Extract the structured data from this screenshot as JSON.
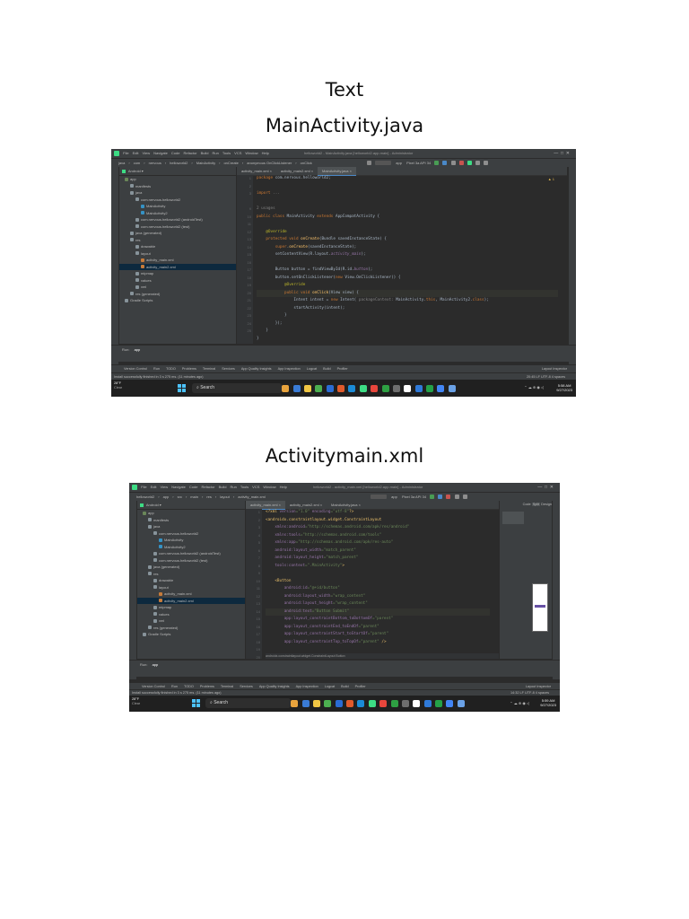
{
  "headings": {
    "text": "Text",
    "java": "MainActivity.java",
    "xml": "Activitymain.xml"
  },
  "ide": {
    "menu": [
      "File",
      "Edit",
      "View",
      "Navigate",
      "Code",
      "Refactor",
      "Build",
      "Run",
      "Tools",
      "VCS",
      "Window",
      "Help"
    ],
    "project_dropdown": "Android",
    "run_config": "app",
    "device": "Pixel 3a API 34",
    "bottom_tabs": [
      "Version Control",
      "Run",
      "TODO",
      "Problems",
      "Terminal",
      "Services",
      "App Quality Insights",
      "App Inspection",
      "Logcat",
      "Build",
      "Profiler"
    ],
    "layout_inspector": "Layout Inspector",
    "status_message": "Install successfully finished in 3 s 275 ms. (11 minutes ago)",
    "run_tab": "Run:",
    "run_app": "app"
  },
  "tree": [
    {
      "label": "app",
      "indent": 1,
      "color": "#6a8759"
    },
    {
      "label": "manifests",
      "indent": 2,
      "color": "#87939a"
    },
    {
      "label": "java",
      "indent": 2,
      "color": "#87939a"
    },
    {
      "label": "com.nervous.helloworld2",
      "indent": 3,
      "color": "#87939a"
    },
    {
      "label": "MainActivity",
      "indent": 4,
      "color": "#3592c4"
    },
    {
      "label": "MainActivity2",
      "indent": 4,
      "color": "#3592c4"
    },
    {
      "label": "com.nervous.helloworld2 (androidTest)",
      "indent": 3,
      "color": "#87939a"
    },
    {
      "label": "com.nervous.helloworld2 (test)",
      "indent": 3,
      "color": "#87939a"
    },
    {
      "label": "java (generated)",
      "indent": 2,
      "color": "#87939a"
    },
    {
      "label": "res",
      "indent": 2,
      "color": "#87939a"
    },
    {
      "label": "drawable",
      "indent": 3,
      "color": "#87939a"
    },
    {
      "label": "layout",
      "indent": 3,
      "color": "#87939a"
    },
    {
      "label": "activity_main.xml",
      "indent": 4,
      "color": "#c67b3a"
    },
    {
      "label": "activity_main2.xml",
      "indent": 4,
      "color": "#c67b3a"
    },
    {
      "label": "mipmap",
      "indent": 3,
      "color": "#87939a"
    },
    {
      "label": "values",
      "indent": 3,
      "color": "#87939a"
    },
    {
      "label": "xml",
      "indent": 3,
      "color": "#87939a"
    },
    {
      "label": "res (generated)",
      "indent": 2,
      "color": "#87939a"
    },
    {
      "label": "Gradle Scripts",
      "indent": 1,
      "color": "#87939a"
    }
  ],
  "shot1": {
    "title": "helloworld2 - MainActivity.java [helloworld2.app.main] - Administrator",
    "breadcrumb": [
      "java",
      "com",
      "nervous",
      "helloworld2",
      "MainActivity",
      "onCreate",
      "anonymous OnClickListener",
      "onClick"
    ],
    "tabs": [
      "activity_main.xml",
      "activity_main2.xml",
      "MainActivity.java"
    ],
    "line_numbers": [
      "1",
      "2",
      "3",
      "",
      "9",
      "10",
      "11",
      "12",
      "13",
      "14",
      "15",
      "16",
      "17",
      "18",
      "19",
      "20",
      "21",
      "22",
      "23",
      "24",
      "25"
    ],
    "code": [
      [
        [
          "kw",
          "package "
        ],
        [
          "",
          "com.nervous.helloworld2;"
        ]
      ],
      [
        [
          "",
          ""
        ]
      ],
      [
        [
          "kw",
          "import "
        ],
        [
          "cm",
          "..."
        ]
      ],
      [
        [
          "",
          ""
        ]
      ],
      [
        [
          "cm",
          "2 usages"
        ]
      ],
      [
        [
          "kw",
          "public class "
        ],
        [
          "",
          "MainActivity "
        ],
        [
          "kw",
          "extends "
        ],
        [
          "",
          "AppCompatActivity {"
        ]
      ],
      [
        [
          "",
          ""
        ]
      ],
      [
        [
          "an",
          "    @Override"
        ]
      ],
      [
        [
          "kw",
          "    protected void "
        ],
        [
          "fn",
          "onCreate"
        ],
        [
          "",
          "(Bundle savedInstanceState) {"
        ]
      ],
      [
        [
          "kw",
          "        super"
        ],
        [
          "",
          "."
        ],
        [
          "fn",
          "onCreate"
        ],
        [
          "",
          "(savedInstanceState);"
        ]
      ],
      [
        [
          "",
          "        setContentView(R.layout."
        ],
        [
          "it",
          "activity_main"
        ],
        [
          "",
          ");"
        ]
      ],
      [
        [
          "",
          ""
        ]
      ],
      [
        [
          "",
          "        Button button = findViewById(R.id."
        ],
        [
          "it",
          "button"
        ],
        [
          "",
          ");"
        ]
      ],
      [
        [
          "",
          "        button.setOnClickListener("
        ],
        [
          "kw",
          "new "
        ],
        [
          "",
          "View.OnClickListener() {"
        ]
      ],
      [
        [
          "an",
          "            @Override"
        ]
      ],
      [
        [
          "kw",
          "            public void "
        ],
        [
          "fn",
          "onClick"
        ],
        [
          "",
          "(View view) {"
        ]
      ],
      [
        [
          "",
          "                Intent intent = "
        ],
        [
          "kw",
          "new "
        ],
        [
          "",
          "Intent( "
        ],
        [
          "cm",
          "packageContext: "
        ],
        [
          "",
          "MainActivity."
        ],
        [
          "kw",
          "this"
        ],
        [
          "",
          ", MainActivity2."
        ],
        [
          "kw",
          "class"
        ],
        [
          "",
          ");"
        ]
      ],
      [
        [
          "",
          "                startActivity(intent);"
        ]
      ],
      [
        [
          "",
          "            }"
        ]
      ],
      [
        [
          "",
          "        });"
        ]
      ],
      [
        [
          "",
          "    }"
        ]
      ],
      [
        [
          "",
          "}"
        ]
      ]
    ],
    "status_right": "20:45  LF  UTF-8  4 spaces",
    "clock_time": "5:58 AM",
    "clock_date": "9/27/2023",
    "weather_temp": "28°F",
    "weather_text": "Clear",
    "search_label": "Search",
    "warning_count": "▲ 1"
  },
  "shot2": {
    "title": "helloworld2 - activity_main.xml [helloworld2.app.main] - Administrator",
    "breadcrumb": [
      "helloworld2",
      "app",
      "src",
      "main",
      "res",
      "layout",
      "activity_main.xml"
    ],
    "tabs": [
      "activity_main.xml",
      "activity_main2.xml",
      "MainActivity.java"
    ],
    "line_numbers": [
      "1",
      "2",
      "3",
      "4",
      "5",
      "6",
      "7",
      "8",
      "9",
      "10",
      "11",
      "12",
      "13",
      "14",
      "15",
      "16",
      "17",
      "18",
      "19",
      "20",
      "21"
    ],
    "code": [
      [
        [
          "tg",
          "<?xml "
        ],
        [
          "at",
          "version"
        ],
        [
          "st",
          "=\"1.0\" "
        ],
        [
          "at",
          "encoding"
        ],
        [
          "st",
          "=\"utf-8\""
        ],
        [
          "tg",
          "?>"
        ]
      ],
      [
        [
          "tg",
          "<androidx.constraintlayout.widget.ConstraintLayout"
        ]
      ],
      [
        [
          "at",
          "    xmlns:android"
        ],
        [
          "st",
          "=\"http://schemas.android.com/apk/res/android\""
        ]
      ],
      [
        [
          "at",
          "    xmlns:tools"
        ],
        [
          "st",
          "=\"http://schemas.android.com/tools\""
        ]
      ],
      [
        [
          "at",
          "    xmlns:app"
        ],
        [
          "st",
          "=\"http://schemas.android.com/apk/res-auto\""
        ]
      ],
      [
        [
          "at",
          "    android:layout_width"
        ],
        [
          "st",
          "=\"match_parent\""
        ]
      ],
      [
        [
          "at",
          "    android:layout_height"
        ],
        [
          "st",
          "=\"match_parent\""
        ]
      ],
      [
        [
          "at",
          "    tools:context"
        ],
        [
          "st",
          "=\".MainActivity\""
        ],
        [
          "tg",
          ">"
        ]
      ],
      [
        [
          "",
          ""
        ]
      ],
      [
        [
          "tg",
          "    <Button"
        ]
      ],
      [
        [
          "at",
          "        android:id"
        ],
        [
          "st",
          "=\"@+id/button\""
        ]
      ],
      [
        [
          "at",
          "        android:layout_width"
        ],
        [
          "st",
          "=\"wrap_content\""
        ]
      ],
      [
        [
          "at",
          "        android:layout_height"
        ],
        [
          "st",
          "=\"wrap_content\""
        ]
      ],
      [
        [
          "at",
          "        android:text"
        ],
        [
          "st",
          "=\"Button Submit\""
        ]
      ],
      [
        [
          "at",
          "        app:layout_constraintBottom_toBottomOf"
        ],
        [
          "st",
          "=\"parent\""
        ]
      ],
      [
        [
          "at",
          "        app:layout_constraintEnd_toEndOf"
        ],
        [
          "st",
          "=\"parent\""
        ]
      ],
      [
        [
          "at",
          "        app:layout_constraintStart_toStartOf"
        ],
        [
          "st",
          "=\"parent\""
        ]
      ],
      [
        [
          "at",
          "        app:layout_constraintTop_toTopOf"
        ],
        [
          "st",
          "=\"parent\" "
        ],
        [
          "tg",
          "/>"
        ]
      ],
      [
        [
          "",
          ""
        ]
      ],
      [
        [
          "tg",
          "</androidx.constraintlayout.widget.ConstraintLayout>"
        ]
      ]
    ],
    "crumb_bottom": "androidx.constraintlayout.widget.ConstraintLayout   Button",
    "view_modes": [
      "Code",
      "Split",
      "Design"
    ],
    "status_right": "14:32  LF  UTF-8  4 spaces",
    "clock_time": "5:59 AM",
    "clock_date": "9/27/2023",
    "weather_temp": "28°F",
    "weather_text": "Clear",
    "search_label": "Search"
  },
  "taskbar_app_colors": [
    "#e8a33d",
    "#3a7bd5",
    "#f2c744",
    "#4caf50",
    "#2a6cd4",
    "#e05a2b",
    "#1b8bd6",
    "#3ddc84",
    "#e8463c",
    "#2ea043",
    "#6e6e6e",
    "#ffffff",
    "#2f7ad9",
    "#24a148",
    "#4285f4",
    "#6aa1e6"
  ]
}
